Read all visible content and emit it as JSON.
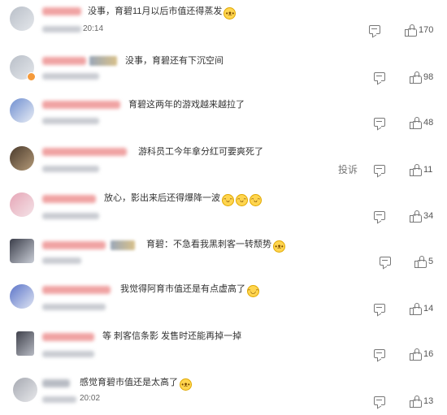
{
  "comments": [
    {
      "text": "没事，育碧11月以后市值还得蒸发",
      "emoji": "doge-emoji",
      "time": "20:14",
      "likes": "170",
      "name_color": "pink"
    },
    {
      "text": "没事，育碧还有下沉空间",
      "emoji": "",
      "time": "",
      "likes": "98",
      "name_color": "pink"
    },
    {
      "text": "育碧这两年的游戏越来越拉了",
      "emoji": "",
      "time": "",
      "likes": "48",
      "name_color": "pink"
    },
    {
      "text": "游科员工今年拿分红可要爽死了",
      "emoji": "",
      "time": "",
      "likes": "11",
      "name_color": "pink",
      "report": "投诉"
    },
    {
      "text": "放心，影出来后还得爆降一波",
      "emoji": "yum-emoji",
      "time": "",
      "likes": "34",
      "name_color": "pink"
    },
    {
      "text": "育碧：不急看我黑刺客一转颓势",
      "emoji": "doge-emoji",
      "time": "",
      "likes": "5",
      "name_color": "pink"
    },
    {
      "text": "我觉得阿育市值还是有点虚高了",
      "emoji": "grin-emoji",
      "time": "",
      "likes": "14",
      "name_color": "pink"
    },
    {
      "text": "等 刺客信条影 发售时还能再掉一掉",
      "emoji": "",
      "time": "",
      "likes": "16",
      "name_color": "pink"
    },
    {
      "text": "感觉育碧市值还是太高了",
      "emoji": "doge-emoji",
      "time": "20:02",
      "likes": "13",
      "name_color": "grey"
    }
  ]
}
